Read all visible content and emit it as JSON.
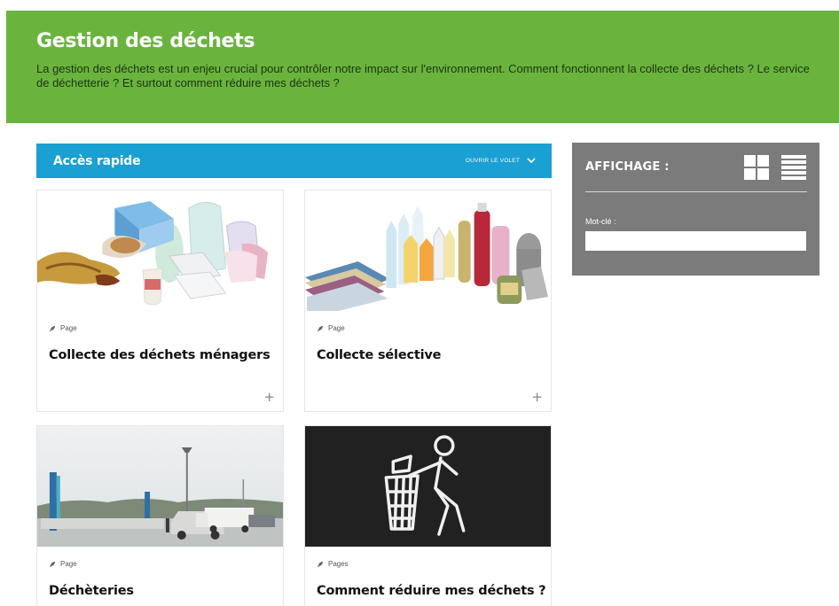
{
  "hero": {
    "title": "Gestion des déchets",
    "description": "La gestion des déchets est un enjeu crucial pour contrôler notre impact sur l'environnement. Comment fonctionnent la collecte des déchets ? Le service de déchetterie ? Et surtout comment réduire mes déchets ?",
    "background_color": "#6ab43e"
  },
  "quick_access": {
    "title": "Accès rapide",
    "open_label": "OUVRIR LE VOLET",
    "icon": "chevron-down-icon",
    "background_color": "#1aa0d2"
  },
  "cards": [
    {
      "type_label": "Page",
      "title": "Collecte des déchets ménagers",
      "image": "household-waste-image",
      "more_icon": "+"
    },
    {
      "type_label": "Page",
      "title": "Collecte sélective",
      "image": "recyclables-image",
      "more_icon": "+"
    },
    {
      "type_label": "Page",
      "title": "Déchèteries",
      "image": "recycling-center-image"
    },
    {
      "type_label": "Pages",
      "title": "Comment réduire mes déchets ?",
      "image": "trash-pictogram-image"
    }
  ],
  "display_panel": {
    "title": "AFFICHAGE :",
    "grid_view_icon": "grid-view-icon",
    "list_view_icon": "list-view-icon",
    "keyword_label": "Mot-clé :",
    "keyword_value": "",
    "background_color": "#7b7b7b"
  }
}
